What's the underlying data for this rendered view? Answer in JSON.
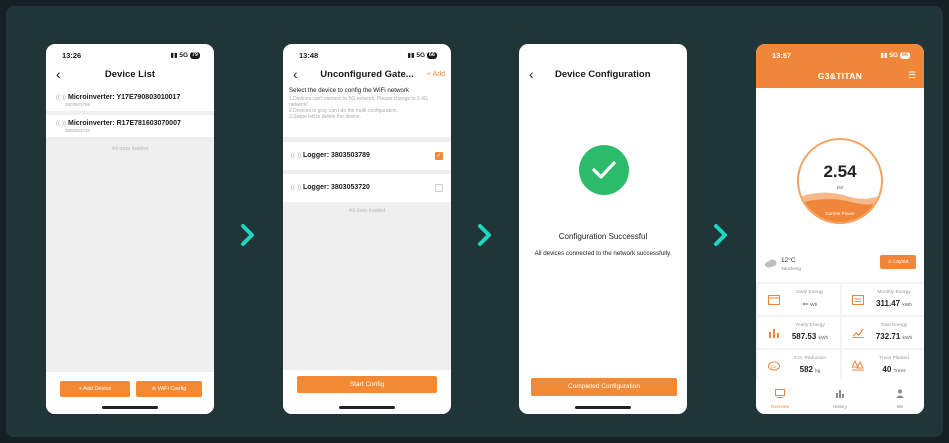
{
  "colors": {
    "accent": "#f28a35",
    "success": "#2bbb6b",
    "arrow": "#1fd6c2"
  },
  "phone1": {
    "time": "13:26",
    "signal": "5G",
    "battery": "79",
    "title": "Device List",
    "devices": [
      {
        "name": "Microinverter: Y17E790803010017",
        "sub": "3803503789"
      },
      {
        "name": "Microinverter: R17E781603070007",
        "sub": "3803053720"
      }
    ],
    "all_loaded": "All data loaded",
    "add_device": "+ Add Device",
    "wifi_config": "WiFi Config"
  },
  "phone2": {
    "time": "13:48",
    "signal": "5G",
    "battery": "66",
    "title": "Unconfigured Gate...",
    "add": "+ Add",
    "heading": "Select the device to config the WiFi network",
    "notes": "1.Devices can't connect to 5G network. Please change to 2.4G network!\n2.Devices in gray can't do the multi-configuration.\n3.Swipe left to delete the device.",
    "gateways": [
      {
        "name": "Logger: 3803503789",
        "checked": true
      },
      {
        "name": "Logger: 3803053720",
        "checked": false
      }
    ],
    "all_loaded": "All data loaded",
    "start": "Start Config"
  },
  "phone3": {
    "title": "Device Configuration",
    "success": "Configuration Successful",
    "message": "All devices connected to the network successfully.",
    "button": "Completed Configuration"
  },
  "phone4": {
    "time": "13:57",
    "signal": "5G",
    "battery": "66",
    "brand": "G3&TITAN",
    "power": "2.54",
    "power_unit": "kW",
    "power_label": "Current Power",
    "power_fill": 0.35,
    "temp": "12°C",
    "city": "Yancheng",
    "layout": "Layout",
    "stats": [
      {
        "label": "Daily Energy",
        "value": "--",
        "unit": "Wh",
        "icon": "calendar-icon"
      },
      {
        "label": "Monthly Energy",
        "value": "311.47",
        "unit": "kWh",
        "icon": "calendar-month-icon"
      },
      {
        "label": "Yearly Energy",
        "value": "587.53",
        "unit": "kWh",
        "icon": "bar-chart-icon"
      },
      {
        "label": "Total Energy",
        "value": "732.71",
        "unit": "kWh",
        "icon": "line-chart-icon"
      },
      {
        "label": "CO₂ Reduction",
        "value": "582",
        "unit": "kg",
        "icon": "co2-icon"
      },
      {
        "label": "Trees Planted",
        "value": "40",
        "unit": "Trees",
        "icon": "tree-icon"
      }
    ],
    "tabs": [
      {
        "label": "Overview",
        "active": true
      },
      {
        "label": "History",
        "active": false
      },
      {
        "label": "Me",
        "active": false
      }
    ]
  }
}
